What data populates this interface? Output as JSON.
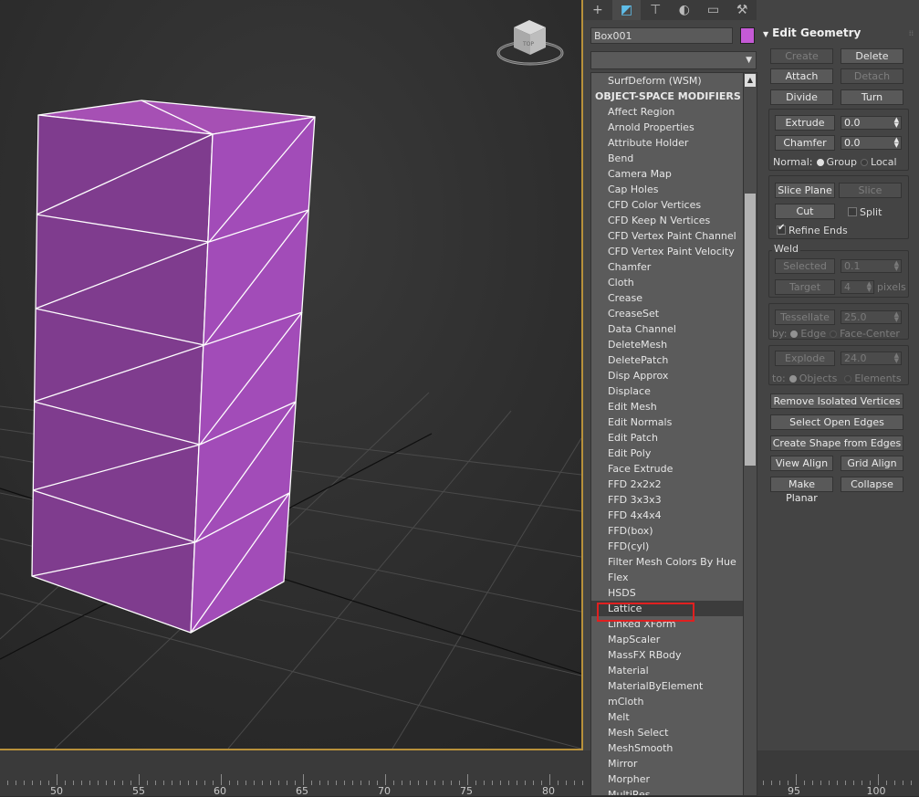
{
  "viewport": {
    "viewcube_label": "TOP",
    "box_color": "#c55ad6"
  },
  "ruler": {
    "labels": [
      "50",
      "55",
      "60",
      "65",
      "70",
      "75",
      "80",
      "95",
      "100"
    ]
  },
  "command_panel": {
    "tabs": [
      "create-icon",
      "modify-icon",
      "hierarchy-icon",
      "motion-icon",
      "display-icon",
      "utilities-icon"
    ],
    "object_name": "Box001",
    "object_color": "#c55ad6"
  },
  "modifier_list": {
    "items": [
      "SurfDeform (WSM)",
      "OBJECT-SPACE MODIFIERS",
      "Affect Region",
      "Arnold Properties",
      "Attribute Holder",
      "Bend",
      "Camera Map",
      "Cap Holes",
      "CFD Color Vertices",
      "CFD Keep N Vertices",
      "CFD Vertex Paint Channel",
      "CFD Vertex Paint Velocity",
      "Chamfer",
      "Cloth",
      "Crease",
      "CreaseSet",
      "Data Channel",
      "DeleteMesh",
      "DeletePatch",
      "Disp Approx",
      "Displace",
      "Edit Mesh",
      "Edit Normals",
      "Edit Patch",
      "Edit Poly",
      "Face Extrude",
      "FFD 2x2x2",
      "FFD 3x3x3",
      "FFD 4x4x4",
      "FFD(box)",
      "FFD(cyl)",
      "Filter Mesh Colors By Hue",
      "Flex",
      "HSDS",
      "Lattice",
      "Linked XForm",
      "MapScaler",
      "MassFX RBody",
      "Material",
      "MaterialByElement",
      "mCloth",
      "Melt",
      "Mesh Select",
      "MeshSmooth",
      "Mirror",
      "Morpher",
      "MultiRes"
    ],
    "header_index": 1,
    "selected": "Lattice"
  },
  "edit_geometry": {
    "title": "Edit Geometry",
    "create": "Create",
    "delete": "Delete",
    "attach": "Attach",
    "detach": "Detach",
    "divide": "Divide",
    "turn": "Turn",
    "extrude": "Extrude",
    "extrude_val": "0.0",
    "chamfer": "Chamfer",
    "chamfer_val": "0.0",
    "normal_label": "Normal:",
    "group": "Group",
    "local": "Local",
    "slice_plane": "Slice Plane",
    "slice": "Slice",
    "cut": "Cut",
    "split": "Split",
    "refine_ends": "Refine Ends",
    "weld": "Weld",
    "selected": "Selected",
    "selected_val": "0.1",
    "target": "Target",
    "target_val": "4",
    "pixels": "pixels",
    "tessellate": "Tessellate",
    "tessellate_val": "25.0",
    "by_label": "by:",
    "edge": "Edge",
    "face_center": "Face-Center",
    "explode": "Explode",
    "explode_val": "24.0",
    "to_label": "to:",
    "objects": "Objects",
    "elements": "Elements",
    "remove_isolated": "Remove Isolated Vertices",
    "select_open_edges": "Select Open Edges",
    "create_shape": "Create Shape from Edges",
    "view_align": "View Align",
    "grid_align": "Grid Align",
    "make_planar": "Make Planar",
    "collapse": "Collapse"
  }
}
